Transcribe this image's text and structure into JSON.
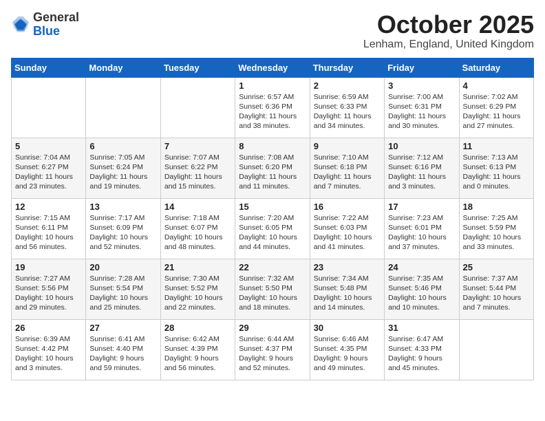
{
  "logo": {
    "general": "General",
    "blue": "Blue"
  },
  "header": {
    "month": "October 2025",
    "location": "Lenham, England, United Kingdom"
  },
  "weekdays": [
    "Sunday",
    "Monday",
    "Tuesday",
    "Wednesday",
    "Thursday",
    "Friday",
    "Saturday"
  ],
  "weeks": [
    [
      {
        "day": "",
        "sunrise": "",
        "sunset": "",
        "daylight": ""
      },
      {
        "day": "",
        "sunrise": "",
        "sunset": "",
        "daylight": ""
      },
      {
        "day": "",
        "sunrise": "",
        "sunset": "",
        "daylight": ""
      },
      {
        "day": "1",
        "sunrise": "Sunrise: 6:57 AM",
        "sunset": "Sunset: 6:36 PM",
        "daylight": "Daylight: 11 hours and 38 minutes."
      },
      {
        "day": "2",
        "sunrise": "Sunrise: 6:59 AM",
        "sunset": "Sunset: 6:33 PM",
        "daylight": "Daylight: 11 hours and 34 minutes."
      },
      {
        "day": "3",
        "sunrise": "Sunrise: 7:00 AM",
        "sunset": "Sunset: 6:31 PM",
        "daylight": "Daylight: 11 hours and 30 minutes."
      },
      {
        "day": "4",
        "sunrise": "Sunrise: 7:02 AM",
        "sunset": "Sunset: 6:29 PM",
        "daylight": "Daylight: 11 hours and 27 minutes."
      }
    ],
    [
      {
        "day": "5",
        "sunrise": "Sunrise: 7:04 AM",
        "sunset": "Sunset: 6:27 PM",
        "daylight": "Daylight: 11 hours and 23 minutes."
      },
      {
        "day": "6",
        "sunrise": "Sunrise: 7:05 AM",
        "sunset": "Sunset: 6:24 PM",
        "daylight": "Daylight: 11 hours and 19 minutes."
      },
      {
        "day": "7",
        "sunrise": "Sunrise: 7:07 AM",
        "sunset": "Sunset: 6:22 PM",
        "daylight": "Daylight: 11 hours and 15 minutes."
      },
      {
        "day": "8",
        "sunrise": "Sunrise: 7:08 AM",
        "sunset": "Sunset: 6:20 PM",
        "daylight": "Daylight: 11 hours and 11 minutes."
      },
      {
        "day": "9",
        "sunrise": "Sunrise: 7:10 AM",
        "sunset": "Sunset: 6:18 PM",
        "daylight": "Daylight: 11 hours and 7 minutes."
      },
      {
        "day": "10",
        "sunrise": "Sunrise: 7:12 AM",
        "sunset": "Sunset: 6:16 PM",
        "daylight": "Daylight: 11 hours and 3 minutes."
      },
      {
        "day": "11",
        "sunrise": "Sunrise: 7:13 AM",
        "sunset": "Sunset: 6:13 PM",
        "daylight": "Daylight: 11 hours and 0 minutes."
      }
    ],
    [
      {
        "day": "12",
        "sunrise": "Sunrise: 7:15 AM",
        "sunset": "Sunset: 6:11 PM",
        "daylight": "Daylight: 10 hours and 56 minutes."
      },
      {
        "day": "13",
        "sunrise": "Sunrise: 7:17 AM",
        "sunset": "Sunset: 6:09 PM",
        "daylight": "Daylight: 10 hours and 52 minutes."
      },
      {
        "day": "14",
        "sunrise": "Sunrise: 7:18 AM",
        "sunset": "Sunset: 6:07 PM",
        "daylight": "Daylight: 10 hours and 48 minutes."
      },
      {
        "day": "15",
        "sunrise": "Sunrise: 7:20 AM",
        "sunset": "Sunset: 6:05 PM",
        "daylight": "Daylight: 10 hours and 44 minutes."
      },
      {
        "day": "16",
        "sunrise": "Sunrise: 7:22 AM",
        "sunset": "Sunset: 6:03 PM",
        "daylight": "Daylight: 10 hours and 41 minutes."
      },
      {
        "day": "17",
        "sunrise": "Sunrise: 7:23 AM",
        "sunset": "Sunset: 6:01 PM",
        "daylight": "Daylight: 10 hours and 37 minutes."
      },
      {
        "day": "18",
        "sunrise": "Sunrise: 7:25 AM",
        "sunset": "Sunset: 5:59 PM",
        "daylight": "Daylight: 10 hours and 33 minutes."
      }
    ],
    [
      {
        "day": "19",
        "sunrise": "Sunrise: 7:27 AM",
        "sunset": "Sunset: 5:56 PM",
        "daylight": "Daylight: 10 hours and 29 minutes."
      },
      {
        "day": "20",
        "sunrise": "Sunrise: 7:28 AM",
        "sunset": "Sunset: 5:54 PM",
        "daylight": "Daylight: 10 hours and 25 minutes."
      },
      {
        "day": "21",
        "sunrise": "Sunrise: 7:30 AM",
        "sunset": "Sunset: 5:52 PM",
        "daylight": "Daylight: 10 hours and 22 minutes."
      },
      {
        "day": "22",
        "sunrise": "Sunrise: 7:32 AM",
        "sunset": "Sunset: 5:50 PM",
        "daylight": "Daylight: 10 hours and 18 minutes."
      },
      {
        "day": "23",
        "sunrise": "Sunrise: 7:34 AM",
        "sunset": "Sunset: 5:48 PM",
        "daylight": "Daylight: 10 hours and 14 minutes."
      },
      {
        "day": "24",
        "sunrise": "Sunrise: 7:35 AM",
        "sunset": "Sunset: 5:46 PM",
        "daylight": "Daylight: 10 hours and 10 minutes."
      },
      {
        "day": "25",
        "sunrise": "Sunrise: 7:37 AM",
        "sunset": "Sunset: 5:44 PM",
        "daylight": "Daylight: 10 hours and 7 minutes."
      }
    ],
    [
      {
        "day": "26",
        "sunrise": "Sunrise: 6:39 AM",
        "sunset": "Sunset: 4:42 PM",
        "daylight": "Daylight: 10 hours and 3 minutes."
      },
      {
        "day": "27",
        "sunrise": "Sunrise: 6:41 AM",
        "sunset": "Sunset: 4:40 PM",
        "daylight": "Daylight: 9 hours and 59 minutes."
      },
      {
        "day": "28",
        "sunrise": "Sunrise: 6:42 AM",
        "sunset": "Sunset: 4:39 PM",
        "daylight": "Daylight: 9 hours and 56 minutes."
      },
      {
        "day": "29",
        "sunrise": "Sunrise: 6:44 AM",
        "sunset": "Sunset: 4:37 PM",
        "daylight": "Daylight: 9 hours and 52 minutes."
      },
      {
        "day": "30",
        "sunrise": "Sunrise: 6:46 AM",
        "sunset": "Sunset: 4:35 PM",
        "daylight": "Daylight: 9 hours and 49 minutes."
      },
      {
        "day": "31",
        "sunrise": "Sunrise: 6:47 AM",
        "sunset": "Sunset: 4:33 PM",
        "daylight": "Daylight: 9 hours and 45 minutes."
      },
      {
        "day": "",
        "sunrise": "",
        "sunset": "",
        "daylight": ""
      }
    ]
  ]
}
